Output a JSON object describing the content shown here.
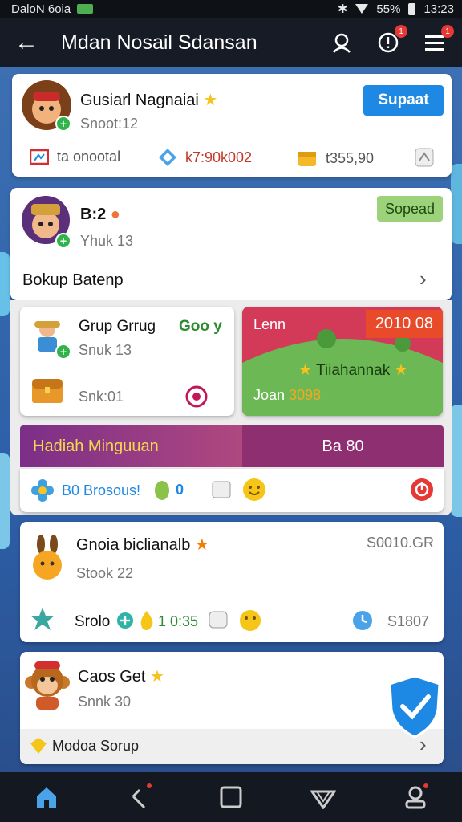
{
  "status_bar": {
    "carrier": "DaloN 6oia",
    "battery": "55%",
    "time": "13:23"
  },
  "header": {
    "title": "Mdan Nosail Sdansan",
    "notif_badge": "1",
    "menu_badge": "1"
  },
  "card1": {
    "name": "Gusiarl Nagnaiai",
    "sub": "Snoot:12",
    "button": "Supaat",
    "stats": [
      "ta onootal",
      "k7:90k002",
      "t355,90"
    ]
  },
  "card2": {
    "name": "B:2",
    "sub": "Yhuk 13",
    "button": "Sopead",
    "row_label": "Bokup Batenp"
  },
  "card3": {
    "name": "Grup Grrug",
    "tag": "Goo y",
    "sub": "Snuk 13",
    "sub2": "Snk:01"
  },
  "card4": {
    "title": "Lenn",
    "badge": "2010 08",
    "center": "Tiiahannak",
    "bottom": "Joan",
    "bottom_value": "3098"
  },
  "weekly": {
    "label": "Hadiah Minguuan",
    "value": "Ba 80",
    "stat_text": "B0 Brosous!",
    "stat_num": "0"
  },
  "card5": {
    "name": "Gnoia biclianalb",
    "sub": "Stook 22",
    "price": "S0010.GR",
    "stat_label": "Srolo",
    "stat_num": "1 0:35",
    "price2": "S1807"
  },
  "card6": {
    "name": "Caos Get",
    "sub": "Snnk 30",
    "footer": "Modoa Sorup"
  },
  "colors": {
    "header_bg": "#171b26",
    "accent_blue": "#1e88e5",
    "accent_green": "#9bd27a",
    "banner_red": "#d23a58",
    "banner_purple": "#8e2f82"
  }
}
